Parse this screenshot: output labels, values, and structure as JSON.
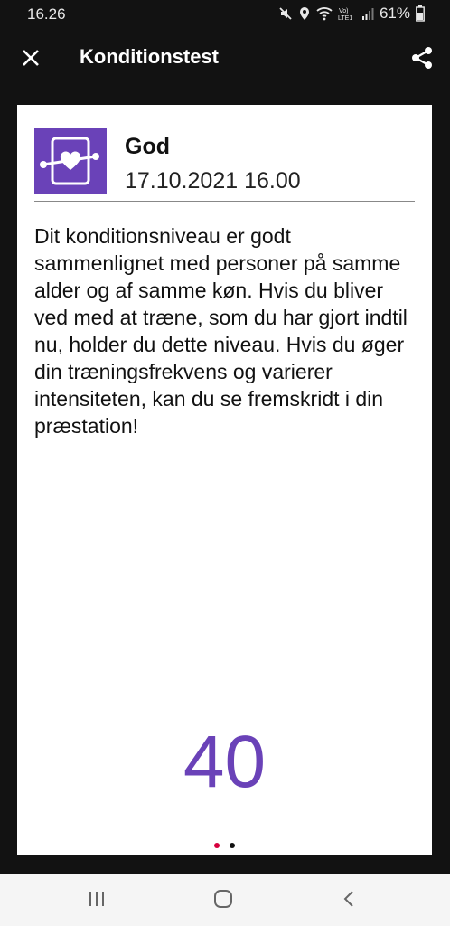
{
  "status_bar": {
    "time": "16.26",
    "battery": "61%",
    "icons": [
      "mute-icon",
      "location-icon",
      "wifi-icon",
      "volte-icon",
      "signal-icon",
      "battery-icon"
    ]
  },
  "app_bar": {
    "title": "Konditionstest",
    "close_icon": "close-icon",
    "share_icon": "share-icon"
  },
  "card": {
    "result_label": "God",
    "date": "17.10.2021 16.00",
    "description": "Dit konditionsniveau er godt sammenlignet med personer på samme alder og af samme køn. Hvis du bliver ved med at træne, som du har gjort indtil nu, holder du dette niveau. Hvis du øger din træningsfrekvens og varierer intensiteten, kan du se fremskridt i din præstation!",
    "score": "40",
    "accent_color": "#6a42b8",
    "pager": {
      "total": 2,
      "active": 1,
      "active_color": "#d6003d"
    }
  },
  "nav_bar": {
    "buttons": [
      "recents-icon",
      "home-icon",
      "back-icon"
    ]
  }
}
